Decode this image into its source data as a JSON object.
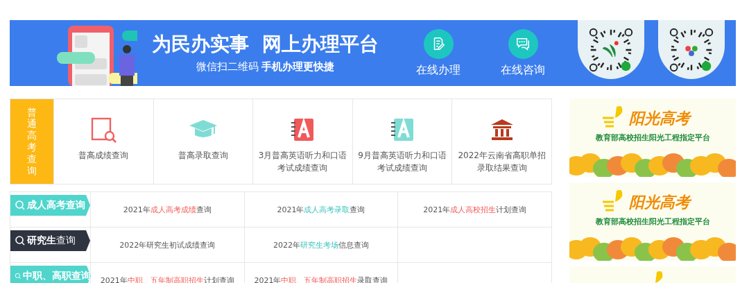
{
  "banner": {
    "title": "为民办实事  网上办理平台",
    "subtitle": "微信扫二维码 **手机办理更快捷**",
    "services": [
      {
        "kind": "edit",
        "label": "在线办理"
      },
      {
        "kind": "chat",
        "label": "在线咨询"
      }
    ],
    "qr_codes": [
      {
        "kind": "green"
      },
      {
        "kind": "color"
      }
    ]
  },
  "gaokao": {
    "label": "普通高考查询",
    "items": [
      {
        "kind": "search-doc",
        "label": "普高成绩查询"
      },
      {
        "kind": "cap",
        "label": "普高录取查询"
      },
      {
        "kind": "book-red",
        "label": "3月普高英语听力和口语考试成绩查询"
      },
      {
        "kind": "book-teal",
        "label": "9月普高英语听力和口语考试成绩查询"
      },
      {
        "kind": "hall",
        "label": "2022年云南省高职单招录取结果查询"
      }
    ]
  },
  "query_rows": [
    {
      "header": "**成人高考查询**",
      "color": "#4fd5cc",
      "cells": [
        [
          {
            "text": "2021年"
          },
          {
            "text": "成人高考成绩",
            "kind": "red"
          },
          {
            "text": "查询"
          }
        ],
        [
          {
            "text": "2021年"
          },
          {
            "text": "成人高考录取",
            "kind": "teal"
          },
          {
            "text": "查询"
          }
        ],
        [
          {
            "text": "2021年"
          },
          {
            "text": "成人高校招生",
            "kind": "red"
          },
          {
            "text": "计划查询"
          }
        ]
      ]
    },
    {
      "header": "**研究生**查询",
      "color": "#2e3440",
      "cells": [
        [
          {
            "text": "2022年研究生初试成绩查询"
          }
        ],
        [
          {
            "text": "2022年"
          },
          {
            "text": "研究生考场",
            "kind": "teal"
          },
          {
            "text": "信息查询"
          }
        ],
        []
      ]
    },
    {
      "header": "**中职、高职查询**",
      "color": "#4fd5cc",
      "cells": [
        [
          {
            "text": "2021年"
          },
          {
            "text": "中职、五年制高职招生",
            "kind": "red"
          },
          {
            "text": "计划查询"
          }
        ],
        [
          {
            "text": "2021年"
          },
          {
            "text": "中职、五年制高职招生",
            "kind": "red"
          },
          {
            "text": "录取查询"
          }
        ],
        []
      ]
    }
  ],
  "ads": [
    {
      "title": "阳光高考",
      "subtitle": "教育部高校招生阳光工程指定平台"
    },
    {
      "title": "阳光高考",
      "subtitle": "教育部高校招生阳光工程指定平台"
    }
  ]
}
